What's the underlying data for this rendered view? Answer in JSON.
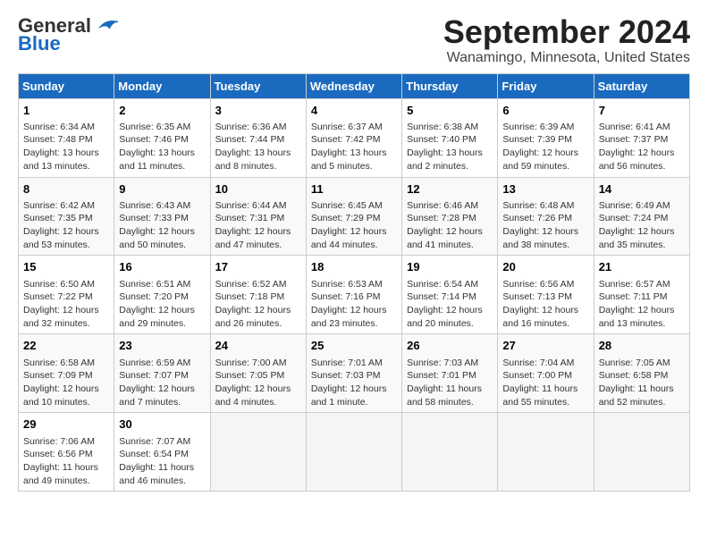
{
  "header": {
    "logo_line1": "General",
    "logo_line2": "Blue",
    "title": "September 2024",
    "subtitle": "Wanamingo, Minnesota, United States"
  },
  "days_of_week": [
    "Sunday",
    "Monday",
    "Tuesday",
    "Wednesday",
    "Thursday",
    "Friday",
    "Saturday"
  ],
  "weeks": [
    [
      {
        "day": 1,
        "sunrise": "6:34 AM",
        "sunset": "7:48 PM",
        "daylight": "13 hours and 13 minutes."
      },
      {
        "day": 2,
        "sunrise": "6:35 AM",
        "sunset": "7:46 PM",
        "daylight": "13 hours and 11 minutes."
      },
      {
        "day": 3,
        "sunrise": "6:36 AM",
        "sunset": "7:44 PM",
        "daylight": "13 hours and 8 minutes."
      },
      {
        "day": 4,
        "sunrise": "6:37 AM",
        "sunset": "7:42 PM",
        "daylight": "13 hours and 5 minutes."
      },
      {
        "day": 5,
        "sunrise": "6:38 AM",
        "sunset": "7:40 PM",
        "daylight": "13 hours and 2 minutes."
      },
      {
        "day": 6,
        "sunrise": "6:39 AM",
        "sunset": "7:39 PM",
        "daylight": "12 hours and 59 minutes."
      },
      {
        "day": 7,
        "sunrise": "6:41 AM",
        "sunset": "7:37 PM",
        "daylight": "12 hours and 56 minutes."
      }
    ],
    [
      {
        "day": 8,
        "sunrise": "6:42 AM",
        "sunset": "7:35 PM",
        "daylight": "12 hours and 53 minutes."
      },
      {
        "day": 9,
        "sunrise": "6:43 AM",
        "sunset": "7:33 PM",
        "daylight": "12 hours and 50 minutes."
      },
      {
        "day": 10,
        "sunrise": "6:44 AM",
        "sunset": "7:31 PM",
        "daylight": "12 hours and 47 minutes."
      },
      {
        "day": 11,
        "sunrise": "6:45 AM",
        "sunset": "7:29 PM",
        "daylight": "12 hours and 44 minutes."
      },
      {
        "day": 12,
        "sunrise": "6:46 AM",
        "sunset": "7:28 PM",
        "daylight": "12 hours and 41 minutes."
      },
      {
        "day": 13,
        "sunrise": "6:48 AM",
        "sunset": "7:26 PM",
        "daylight": "12 hours and 38 minutes."
      },
      {
        "day": 14,
        "sunrise": "6:49 AM",
        "sunset": "7:24 PM",
        "daylight": "12 hours and 35 minutes."
      }
    ],
    [
      {
        "day": 15,
        "sunrise": "6:50 AM",
        "sunset": "7:22 PM",
        "daylight": "12 hours and 32 minutes."
      },
      {
        "day": 16,
        "sunrise": "6:51 AM",
        "sunset": "7:20 PM",
        "daylight": "12 hours and 29 minutes."
      },
      {
        "day": 17,
        "sunrise": "6:52 AM",
        "sunset": "7:18 PM",
        "daylight": "12 hours and 26 minutes."
      },
      {
        "day": 18,
        "sunrise": "6:53 AM",
        "sunset": "7:16 PM",
        "daylight": "12 hours and 23 minutes."
      },
      {
        "day": 19,
        "sunrise": "6:54 AM",
        "sunset": "7:14 PM",
        "daylight": "12 hours and 20 minutes."
      },
      {
        "day": 20,
        "sunrise": "6:56 AM",
        "sunset": "7:13 PM",
        "daylight": "12 hours and 16 minutes."
      },
      {
        "day": 21,
        "sunrise": "6:57 AM",
        "sunset": "7:11 PM",
        "daylight": "12 hours and 13 minutes."
      }
    ],
    [
      {
        "day": 22,
        "sunrise": "6:58 AM",
        "sunset": "7:09 PM",
        "daylight": "12 hours and 10 minutes."
      },
      {
        "day": 23,
        "sunrise": "6:59 AM",
        "sunset": "7:07 PM",
        "daylight": "12 hours and 7 minutes."
      },
      {
        "day": 24,
        "sunrise": "7:00 AM",
        "sunset": "7:05 PM",
        "daylight": "12 hours and 4 minutes."
      },
      {
        "day": 25,
        "sunrise": "7:01 AM",
        "sunset": "7:03 PM",
        "daylight": "12 hours and 1 minute."
      },
      {
        "day": 26,
        "sunrise": "7:03 AM",
        "sunset": "7:01 PM",
        "daylight": "11 hours and 58 minutes."
      },
      {
        "day": 27,
        "sunrise": "7:04 AM",
        "sunset": "7:00 PM",
        "daylight": "11 hours and 55 minutes."
      },
      {
        "day": 28,
        "sunrise": "7:05 AM",
        "sunset": "6:58 PM",
        "daylight": "11 hours and 52 minutes."
      }
    ],
    [
      {
        "day": 29,
        "sunrise": "7:06 AM",
        "sunset": "6:56 PM",
        "daylight": "11 hours and 49 minutes."
      },
      {
        "day": 30,
        "sunrise": "7:07 AM",
        "sunset": "6:54 PM",
        "daylight": "11 hours and 46 minutes."
      },
      null,
      null,
      null,
      null,
      null
    ]
  ]
}
